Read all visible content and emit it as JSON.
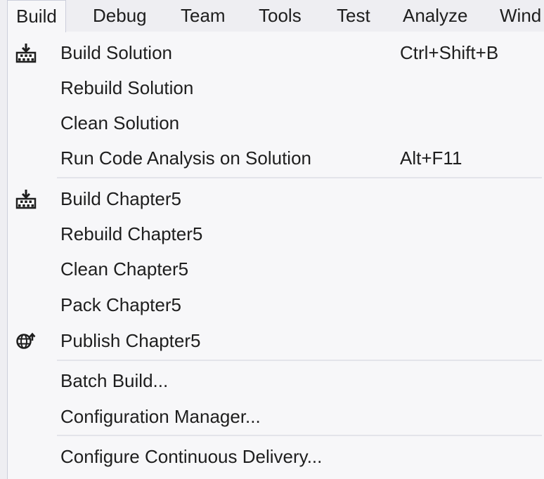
{
  "menubar": {
    "items": [
      {
        "label": "Build"
      },
      {
        "label": "Debug"
      },
      {
        "label": "Team"
      },
      {
        "label": "Tools"
      },
      {
        "label": "Test"
      },
      {
        "label": "Analyze"
      },
      {
        "label": "Wind"
      }
    ]
  },
  "build_menu": {
    "items": [
      {
        "label": "Build Solution",
        "shortcut": "Ctrl+Shift+B",
        "icon": "build-icon"
      },
      {
        "label": "Rebuild Solution"
      },
      {
        "label": "Clean Solution"
      },
      {
        "label": "Run Code Analysis on Solution",
        "shortcut": "Alt+F11"
      },
      {
        "label": "Build Chapter5",
        "icon": "build-icon"
      },
      {
        "label": "Rebuild Chapter5"
      },
      {
        "label": "Clean Chapter5"
      },
      {
        "label": "Pack Chapter5"
      },
      {
        "label": "Publish Chapter5",
        "icon": "publish-globe-icon"
      },
      {
        "label": "Batch Build..."
      },
      {
        "label": "Configuration Manager..."
      },
      {
        "label": "Configure Continuous Delivery..."
      }
    ]
  }
}
